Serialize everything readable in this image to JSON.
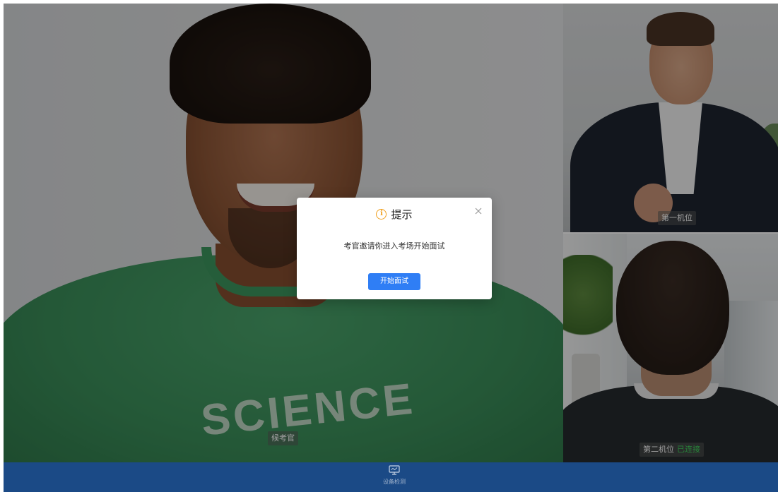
{
  "main_video": {
    "label": "候考官"
  },
  "side_videos": [
    {
      "label": "第一机位",
      "status": ""
    },
    {
      "label": "第二机位",
      "status": "已连接"
    }
  ],
  "dialog": {
    "title": "提示",
    "message": "考官邀请你进入考场开始面试",
    "primary_button": "开始面试",
    "icons": {
      "title": "info-icon",
      "close": "close-icon"
    },
    "accent_color": "#f0a020",
    "button_color": "#2f7ef5"
  },
  "bottom_bar": {
    "device_check_label": "设备检测",
    "icon": "monitor-icon",
    "background_color": "#1b4a86"
  },
  "status_color": "#3fd45c"
}
